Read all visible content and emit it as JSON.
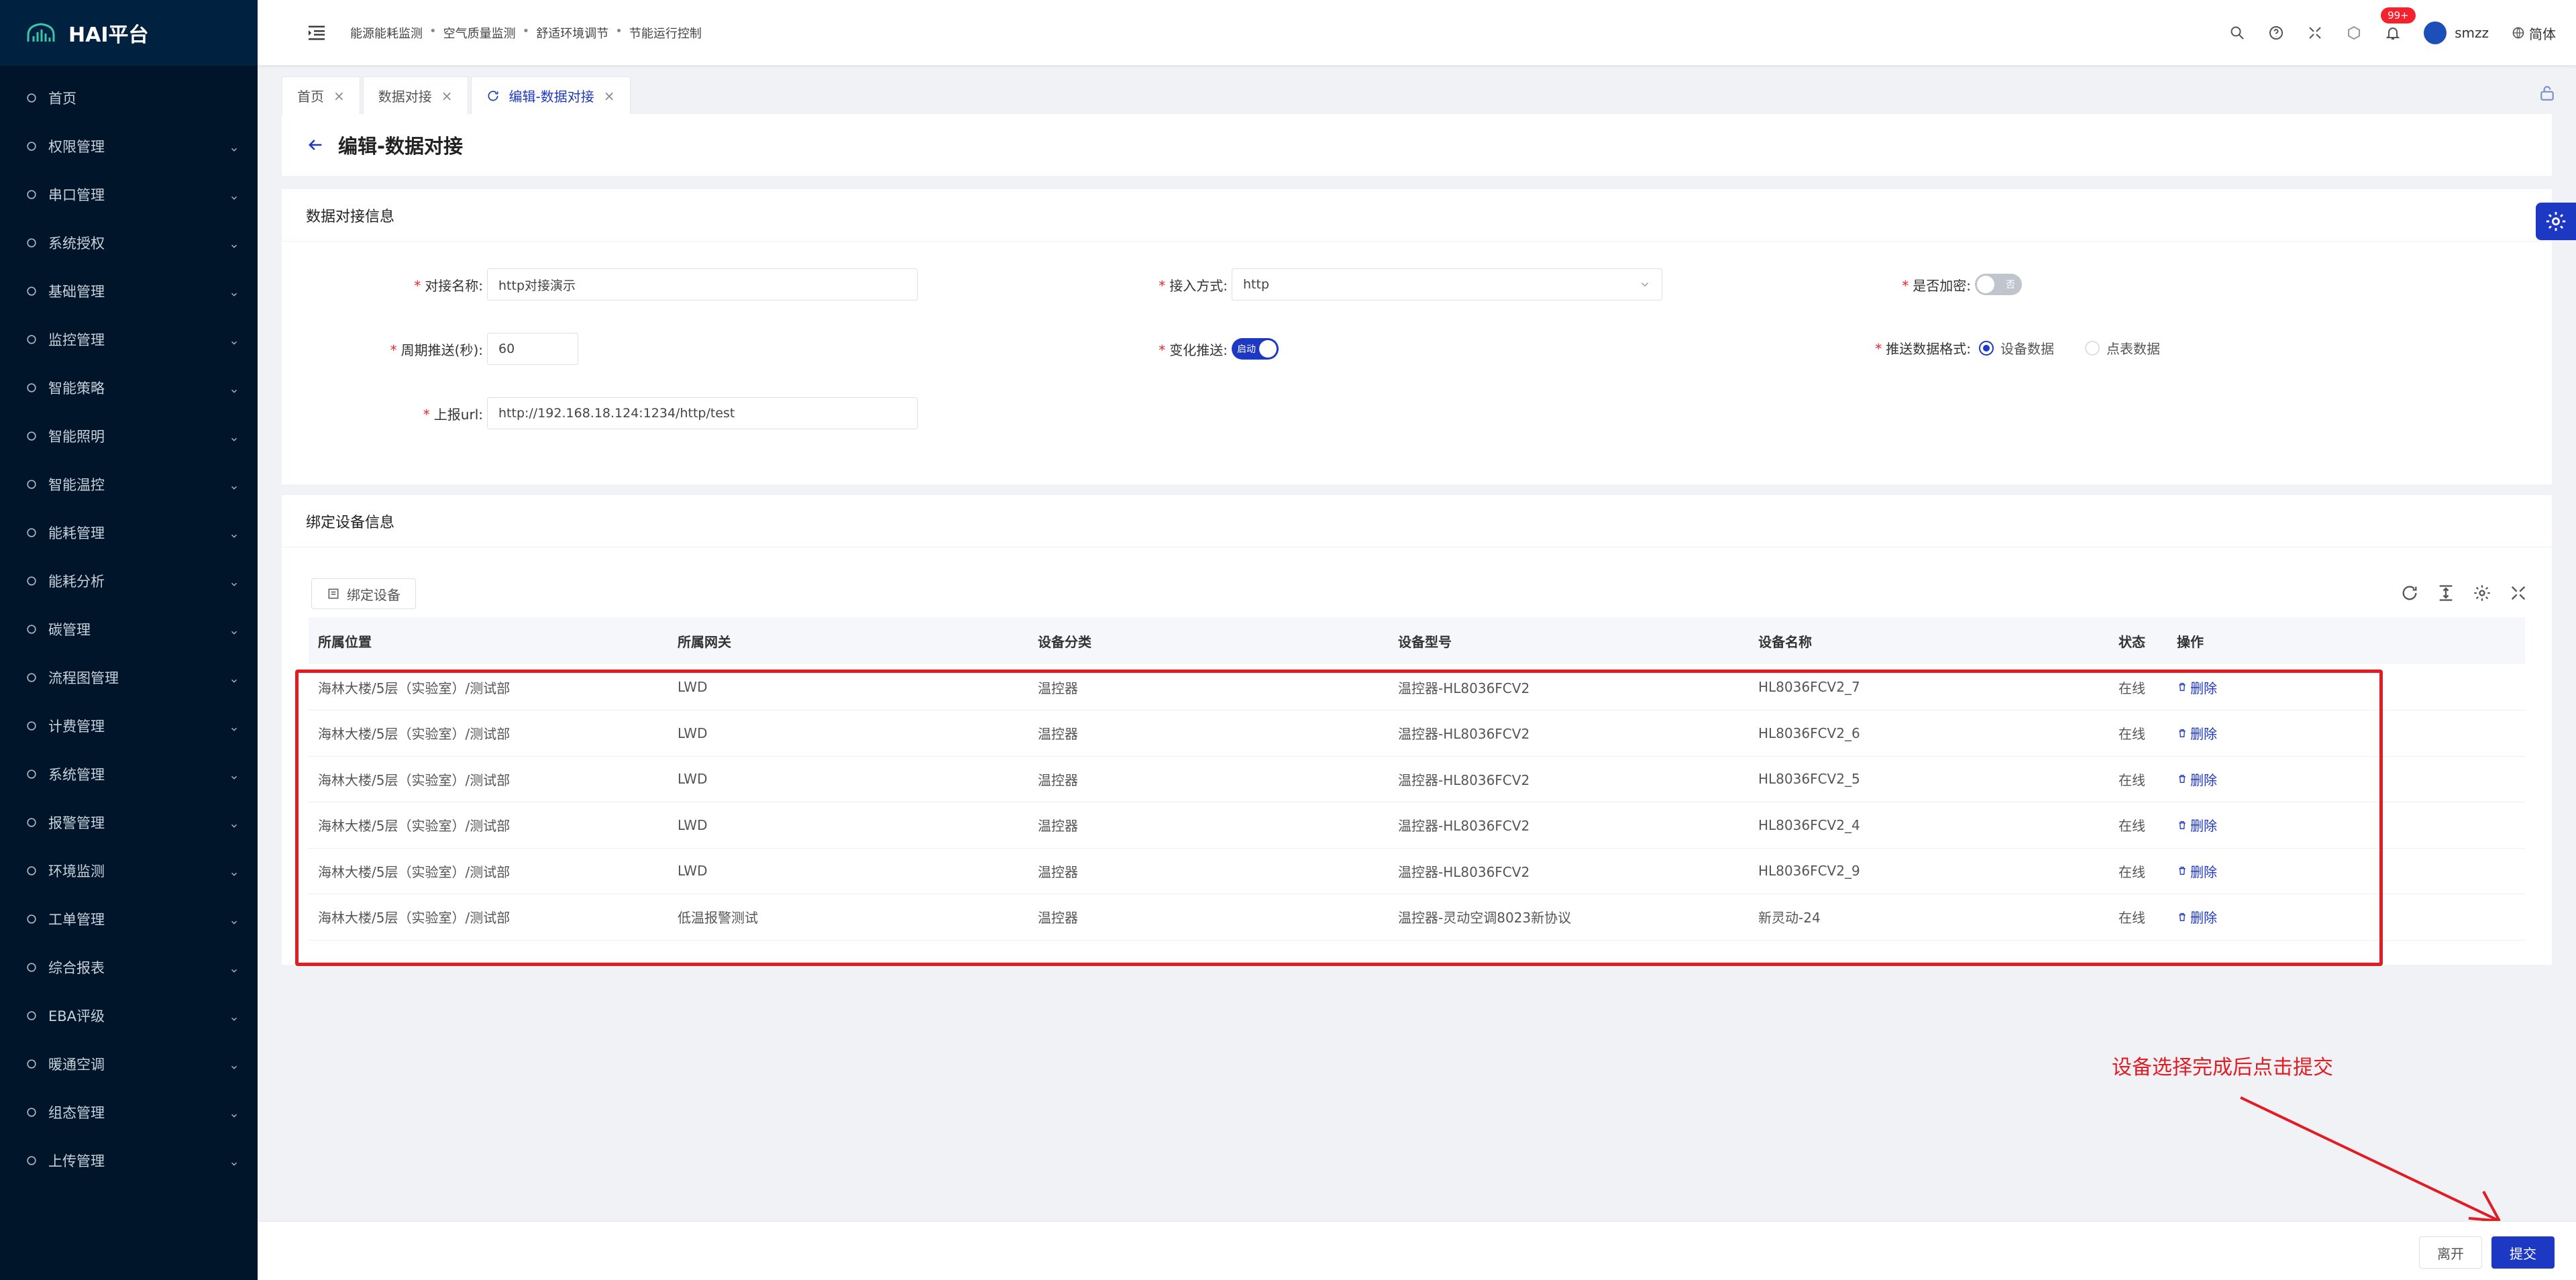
{
  "app": {
    "title": "HAI平台"
  },
  "sidebar": {
    "items": [
      {
        "label": "首页",
        "icon": "dashboard-icon",
        "has_children": false
      },
      {
        "label": "权限管理",
        "icon": "shield-icon",
        "has_children": true
      },
      {
        "label": "串口管理",
        "icon": "sliders-icon",
        "has_children": true
      },
      {
        "label": "系统授权",
        "icon": "grid-icon",
        "has_children": true
      },
      {
        "label": "基础管理",
        "icon": "box-icon",
        "has_children": true
      },
      {
        "label": "监控管理",
        "icon": "monitor-icon",
        "has_children": true
      },
      {
        "label": "智能策略",
        "icon": "bulb-icon",
        "has_children": true
      },
      {
        "label": "智能照明",
        "icon": "lamp-icon",
        "has_children": true
      },
      {
        "label": "智能温控",
        "icon": "thermo-icon",
        "has_children": true
      },
      {
        "label": "能耗管理",
        "icon": "sliders-icon",
        "has_children": true
      },
      {
        "label": "能耗分析",
        "icon": "bar-chart-icon",
        "has_children": true
      },
      {
        "label": "碳管理",
        "icon": "leaf-icon",
        "has_children": true
      },
      {
        "label": "流程图管理",
        "icon": "flow-icon",
        "has_children": true
      },
      {
        "label": "计费管理",
        "icon": "wallet-icon",
        "has_children": true
      },
      {
        "label": "系统管理",
        "icon": "settings-icon",
        "has_children": true
      },
      {
        "label": "报警管理",
        "icon": "bell-icon",
        "has_children": true
      },
      {
        "label": "环境监测",
        "icon": "eco-icon",
        "has_children": true
      },
      {
        "label": "工单管理",
        "icon": "ticket-icon",
        "has_children": true
      },
      {
        "label": "综合报表",
        "icon": "report-icon",
        "has_children": true
      },
      {
        "label": "EBA评级",
        "icon": "rating-icon",
        "has_children": true
      },
      {
        "label": "暖通空调",
        "icon": "hvac-icon",
        "has_children": true
      },
      {
        "label": "组态管理",
        "icon": "config-icon",
        "has_children": true
      },
      {
        "label": "上传管理",
        "icon": "cloud-upload-icon",
        "has_children": true
      }
    ]
  },
  "topbar": {
    "breadcrumbs": [
      "能源能耗监测",
      "空气质量监测",
      "舒适环境调节",
      "节能运行控制"
    ],
    "notification_count": "99+",
    "username": "smzz",
    "language": "简体"
  },
  "tabs": [
    {
      "label": "首页",
      "active": false
    },
    {
      "label": "数据对接",
      "active": false
    },
    {
      "label": "编辑-数据对接",
      "active": true
    }
  ],
  "page": {
    "title": "编辑-数据对接"
  },
  "form": {
    "section_title": "数据对接信息",
    "name_label": "对接名称:",
    "name_value": "http对接演示",
    "access_label": "接入方式:",
    "access_value": "http",
    "encrypt_label": "是否加密:",
    "encrypt_state": "否",
    "period_label": "周期推送(秒):",
    "period_value": "60",
    "change_label": "变化推送:",
    "change_state": "启动",
    "format_label": "推送数据格式:",
    "format_options": [
      "设备数据",
      "点表数据"
    ],
    "format_selected": "设备数据",
    "url_label": "上报url:",
    "url_value": "http://192.168.18.124:1234/http/test"
  },
  "devices": {
    "section_title": "绑定设备信息",
    "bind_button": "绑定设备",
    "columns": [
      "所属位置",
      "所属网关",
      "设备分类",
      "设备型号",
      "设备名称",
      "状态",
      "操作"
    ],
    "rows": [
      [
        "海林大楼/5层（实验室）/测试部",
        "LWD",
        "温控器",
        "温控器-HL8036FCV2",
        "HL8036FCV2_7",
        "在线",
        "删除"
      ],
      [
        "海林大楼/5层（实验室）/测试部",
        "LWD",
        "温控器",
        "温控器-HL8036FCV2",
        "HL8036FCV2_6",
        "在线",
        "删除"
      ],
      [
        "海林大楼/5层（实验室）/测试部",
        "LWD",
        "温控器",
        "温控器-HL8036FCV2",
        "HL8036FCV2_5",
        "在线",
        "删除"
      ],
      [
        "海林大楼/5层（实验室）/测试部",
        "LWD",
        "温控器",
        "温控器-HL8036FCV2",
        "HL8036FCV2_4",
        "在线",
        "删除"
      ],
      [
        "海林大楼/5层（实验室）/测试部",
        "LWD",
        "温控器",
        "温控器-HL8036FCV2",
        "HL8036FCV2_9",
        "在线",
        "删除"
      ],
      [
        "海林大楼/5层（实验室）/测试部",
        "低温报警测试",
        "温控器",
        "温控器-灵动空调8023新协议",
        "新灵动-24",
        "在线",
        "删除"
      ]
    ]
  },
  "annotation": {
    "text": "设备选择完成后点击提交",
    "color": "#e31b23"
  },
  "footer": {
    "leave_label": "离开",
    "submit_label": "提交"
  },
  "colors": {
    "sidebar_bg": "#001529",
    "primary": "#1d39c4",
    "danger": "#f5222d"
  }
}
